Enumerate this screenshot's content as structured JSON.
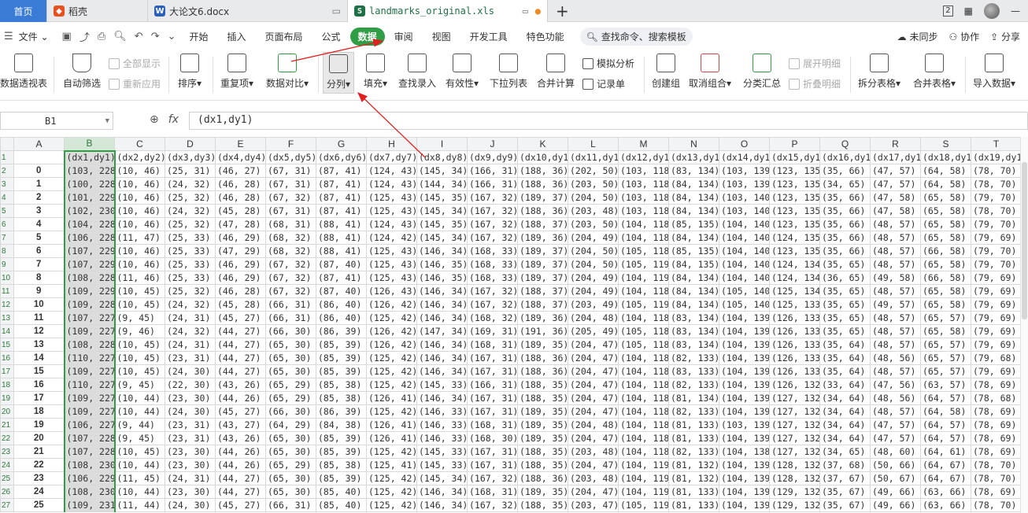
{
  "tabs": {
    "home": "首页",
    "daoke": "稻壳",
    "doc": "大论文6.docx",
    "xls": "landmarks_original.xls",
    "new": "+"
  },
  "window": {
    "badge": "2",
    "minimize": "—"
  },
  "menu": {
    "file": "文件",
    "items": [
      "开始",
      "插入",
      "页面布局",
      "公式",
      "数据",
      "审阅",
      "视图",
      "开发工具",
      "特色功能"
    ],
    "active": "数据",
    "search": "查找命令、搜索模板",
    "sync": "未同步",
    "collab": "协作",
    "share": "分享"
  },
  "ribbon": {
    "pivot": "数据透视表",
    "autofilter": "自动筛选",
    "showall": "全部显示",
    "reapply": "重新应用",
    "sort": "排序",
    "dup": "重复项",
    "compare": "数据对比",
    "split": "分列",
    "fill": "填充",
    "lookup": "查找录入",
    "valid": "有效性",
    "dropdown": "下拉列表",
    "merge": "合并计算",
    "simulate": "模拟分析",
    "record": "记录单",
    "group": "创建组",
    "ungroup": "取消组合",
    "subtotal": "分类汇总",
    "expand": "展开明细",
    "collapse": "折叠明细",
    "splittable": "拆分表格",
    "mergetable": "合并表格",
    "import": "导入数据"
  },
  "formula": {
    "cell": "B1",
    "fx": "fx",
    "content": "(dx1,dy1)"
  },
  "colors": {
    "accent": "#2f9e44",
    "arrow": "#e02020"
  },
  "grid": {
    "columns": [
      "A",
      "B",
      "C",
      "D",
      "E",
      "F",
      "G",
      "H",
      "I",
      "J",
      "K",
      "L",
      "M",
      "N",
      "O",
      "P",
      "Q",
      "R",
      "S",
      "T"
    ],
    "header": [
      "",
      "(dx1,dy1)",
      "(dx2,dy2)",
      "(dx3,dy3)",
      "(dx4,dy4)",
      "(dx5,dy5)",
      "(dx6,dy6)",
      "(dx7,dy7)",
      "(dx8,dy8)",
      "(dx9,dy9)",
      "(dx10,dy10",
      "(dx11,dy11",
      "(dx12,dy12",
      "(dx13,dy13",
      "(dx14,dy14",
      "(dx15,dy15",
      "(dx16,dy16",
      "(dx17,dy17",
      "(dx18,dy18",
      "(dx19,dy1"
    ],
    "rows": [
      [
        "0",
        "(103, 228)",
        "(10, 46)",
        "(25, 31)",
        "(46, 27)",
        "(67, 31)",
        "(87, 41)",
        "(124, 43)",
        "(145, 34)",
        "(166, 31)",
        "(188, 36)",
        "(202, 50)",
        "(103, 118)",
        "(83, 134)",
        "(103, 139)",
        "(123, 135)",
        "(35, 66)",
        "(47, 57)",
        "(64, 58)",
        "(78, 70)"
      ],
      [
        "1",
        "(100, 228)",
        "(10, 46)",
        "(24, 32)",
        "(46, 28)",
        "(67, 31)",
        "(87, 41)",
        "(124, 43)",
        "(144, 34)",
        "(166, 31)",
        "(188, 36)",
        "(203, 50)",
        "(103, 118)",
        "(84, 134)",
        "(103, 139)",
        "(123, 135)",
        "(34, 65)",
        "(47, 57)",
        "(64, 58)",
        "(78, 70)"
      ],
      [
        "2",
        "(101, 229)",
        "(10, 46)",
        "(25, 32)",
        "(46, 28)",
        "(67, 32)",
        "(87, 41)",
        "(125, 43)",
        "(145, 35)",
        "(167, 32)",
        "(189, 37)",
        "(204, 50)",
        "(103, 118)",
        "(84, 134)",
        "(103, 140)",
        "(123, 135)",
        "(35, 66)",
        "(47, 58)",
        "(65, 58)",
        "(79, 70)"
      ],
      [
        "3",
        "(102, 230)",
        "(10, 46)",
        "(24, 32)",
        "(45, 28)",
        "(67, 31)",
        "(87, 41)",
        "(125, 43)",
        "(145, 34)",
        "(167, 32)",
        "(188, 36)",
        "(203, 48)",
        "(103, 118)",
        "(84, 134)",
        "(103, 140)",
        "(123, 135)",
        "(35, 66)",
        "(47, 58)",
        "(65, 58)",
        "(78, 70)"
      ],
      [
        "4",
        "(104, 228)",
        "(10, 46)",
        "(25, 32)",
        "(47, 28)",
        "(68, 31)",
        "(88, 41)",
        "(124, 43)",
        "(145, 35)",
        "(167, 32)",
        "(188, 37)",
        "(203, 50)",
        "(104, 118)",
        "(85, 135)",
        "(104, 140)",
        "(123, 135)",
        "(35, 66)",
        "(48, 57)",
        "(65, 58)",
        "(79, 70)"
      ],
      [
        "5",
        "(106, 228)",
        "(11, 47)",
        "(25, 33)",
        "(46, 29)",
        "(68, 32)",
        "(88, 41)",
        "(124, 42)",
        "(145, 34)",
        "(167, 32)",
        "(189, 36)",
        "(204, 49)",
        "(104, 118)",
        "(84, 134)",
        "(104, 140)",
        "(124, 135)",
        "(35, 66)",
        "(48, 57)",
        "(65, 58)",
        "(79, 69)"
      ],
      [
        "6",
        "(107, 229)",
        "(10, 46)",
        "(25, 33)",
        "(47, 29)",
        "(68, 32)",
        "(88, 41)",
        "(125, 43)",
        "(146, 34)",
        "(168, 33)",
        "(189, 37)",
        "(204, 50)",
        "(105, 118)",
        "(85, 135)",
        "(104, 140)",
        "(123, 135)",
        "(35, 66)",
        "(48, 57)",
        "(66, 58)",
        "(79, 70)"
      ],
      [
        "7",
        "(107, 229)",
        "(10, 46)",
        "(25, 33)",
        "(46, 29)",
        "(67, 32)",
        "(87, 40)",
        "(125, 43)",
        "(146, 35)",
        "(168, 33)",
        "(189, 37)",
        "(204, 50)",
        "(105, 119)",
        "(84, 135)",
        "(104, 140)",
        "(124, 134)",
        "(35, 65)",
        "(48, 57)",
        "(65, 58)",
        "(79, 70)"
      ],
      [
        "8",
        "(108, 228)",
        "(11, 46)",
        "(25, 33)",
        "(46, 29)",
        "(67, 32)",
        "(87, 41)",
        "(125, 43)",
        "(146, 35)",
        "(168, 33)",
        "(189, 37)",
        "(204, 49)",
        "(104, 119)",
        "(84, 134)",
        "(104, 140)",
        "(124, 134)",
        "(36, 65)",
        "(49, 58)",
        "(66, 58)",
        "(79, 69)"
      ],
      [
        "9",
        "(109, 229)",
        "(10, 45)",
        "(25, 32)",
        "(46, 28)",
        "(67, 32)",
        "(87, 40)",
        "(126, 43)",
        "(146, 34)",
        "(167, 32)",
        "(188, 37)",
        "(204, 49)",
        "(104, 118)",
        "(84, 134)",
        "(105, 140)",
        "(125, 134)",
        "(35, 65)",
        "(48, 57)",
        "(65, 58)",
        "(79, 69)"
      ],
      [
        "10",
        "(109, 228)",
        "(10, 45)",
        "(24, 32)",
        "(45, 28)",
        "(66, 31)",
        "(86, 40)",
        "(126, 42)",
        "(146, 34)",
        "(167, 32)",
        "(188, 37)",
        "(203, 49)",
        "(105, 119)",
        "(84, 134)",
        "(105, 140)",
        "(125, 133)",
        "(35, 65)",
        "(49, 57)",
        "(65, 58)",
        "(79, 69)"
      ],
      [
        "11",
        "(107, 227)",
        "(9, 45)",
        "(24, 31)",
        "(45, 27)",
        "(66, 31)",
        "(86, 40)",
        "(125, 42)",
        "(146, 34)",
        "(168, 32)",
        "(189, 36)",
        "(204, 48)",
        "(104, 118)",
        "(83, 134)",
        "(104, 139)",
        "(126, 133)",
        "(35, 65)",
        "(48, 57)",
        "(65, 57)",
        "(79, 69)"
      ],
      [
        "12",
        "(109, 227)",
        "(9, 46)",
        "(24, 32)",
        "(44, 27)",
        "(66, 30)",
        "(86, 39)",
        "(126, 42)",
        "(147, 34)",
        "(169, 31)",
        "(191, 36)",
        "(205, 49)",
        "(105, 118)",
        "(83, 134)",
        "(104, 139)",
        "(126, 133)",
        "(35, 65)",
        "(48, 57)",
        "(65, 58)",
        "(79, 69)"
      ],
      [
        "13",
        "(108, 228)",
        "(10, 45)",
        "(24, 31)",
        "(44, 27)",
        "(65, 30)",
        "(85, 39)",
        "(126, 42)",
        "(146, 34)",
        "(168, 31)",
        "(189, 35)",
        "(204, 47)",
        "(105, 118)",
        "(83, 134)",
        "(104, 139)",
        "(126, 133)",
        "(35, 64)",
        "(48, 57)",
        "(65, 57)",
        "(79, 69)"
      ],
      [
        "14",
        "(110, 227)",
        "(10, 45)",
        "(23, 31)",
        "(44, 27)",
        "(65, 30)",
        "(85, 39)",
        "(125, 42)",
        "(146, 34)",
        "(167, 31)",
        "(188, 36)",
        "(204, 47)",
        "(104, 118)",
        "(82, 133)",
        "(104, 139)",
        "(126, 133)",
        "(35, 64)",
        "(48, 56)",
        "(65, 57)",
        "(79, 68)"
      ],
      [
        "15",
        "(109, 227)",
        "(10, 45)",
        "(24, 30)",
        "(44, 27)",
        "(65, 30)",
        "(85, 39)",
        "(125, 42)",
        "(146, 34)",
        "(167, 31)",
        "(188, 36)",
        "(204, 47)",
        "(104, 118)",
        "(83, 133)",
        "(104, 139)",
        "(126, 133)",
        "(35, 64)",
        "(48, 57)",
        "(65, 57)",
        "(79, 69)"
      ],
      [
        "16",
        "(110, 227)",
        "(9, 45)",
        "(22, 30)",
        "(43, 26)",
        "(65, 29)",
        "(85, 38)",
        "(125, 42)",
        "(145, 33)",
        "(166, 31)",
        "(188, 35)",
        "(204, 47)",
        "(104, 118)",
        "(82, 133)",
        "(104, 139)",
        "(126, 132)",
        "(33, 64)",
        "(47, 56)",
        "(63, 57)",
        "(78, 69)"
      ],
      [
        "17",
        "(109, 227)",
        "(10, 44)",
        "(23, 30)",
        "(44, 26)",
        "(65, 29)",
        "(85, 38)",
        "(126, 41)",
        "(146, 34)",
        "(167, 31)",
        "(188, 35)",
        "(204, 47)",
        "(104, 118)",
        "(81, 134)",
        "(104, 139)",
        "(127, 132)",
        "(34, 64)",
        "(48, 56)",
        "(64, 57)",
        "(78, 68)"
      ],
      [
        "18",
        "(109, 227)",
        "(10, 44)",
        "(24, 30)",
        "(45, 27)",
        "(66, 30)",
        "(86, 39)",
        "(125, 42)",
        "(146, 33)",
        "(167, 31)",
        "(189, 35)",
        "(204, 47)",
        "(104, 118)",
        "(82, 133)",
        "(104, 139)",
        "(127, 132)",
        "(34, 64)",
        "(48, 57)",
        "(64, 58)",
        "(78, 69)"
      ],
      [
        "19",
        "(106, 227)",
        "(9, 44)",
        "(23, 31)",
        "(43, 27)",
        "(64, 29)",
        "(84, 38)",
        "(126, 41)",
        "(146, 33)",
        "(168, 31)",
        "(189, 35)",
        "(204, 48)",
        "(104, 118)",
        "(81, 133)",
        "(103, 139)",
        "(127, 132)",
        "(34, 64)",
        "(47, 57)",
        "(64, 57)",
        "(78, 69)"
      ],
      [
        "20",
        "(107, 228)",
        "(9, 45)",
        "(23, 31)",
        "(43, 26)",
        "(65, 30)",
        "(85, 39)",
        "(126, 41)",
        "(146, 33)",
        "(168, 30)",
        "(189, 35)",
        "(204, 47)",
        "(104, 118)",
        "(81, 133)",
        "(104, 139)",
        "(127, 132)",
        "(34, 64)",
        "(47, 57)",
        "(64, 57)",
        "(78, 69)"
      ],
      [
        "21",
        "(107, 228)",
        "(10, 45)",
        "(23, 30)",
        "(44, 26)",
        "(65, 30)",
        "(85, 39)",
        "(125, 42)",
        "(145, 33)",
        "(167, 31)",
        "(188, 35)",
        "(203, 48)",
        "(104, 118)",
        "(82, 133)",
        "(104, 138)",
        "(127, 132)",
        "(34, 65)",
        "(48, 60)",
        "(64, 61)",
        "(78, 69)"
      ],
      [
        "22",
        "(108, 230)",
        "(10, 44)",
        "(23, 30)",
        "(44, 26)",
        "(65, 29)",
        "(85, 38)",
        "(125, 41)",
        "(145, 33)",
        "(167, 31)",
        "(188, 35)",
        "(204, 47)",
        "(104, 119)",
        "(81, 132)",
        "(104, 139)",
        "(128, 132)",
        "(37, 68)",
        "(50, 66)",
        "(64, 67)",
        "(78, 70)"
      ],
      [
        "23",
        "(106, 229)",
        "(11, 45)",
        "(24, 31)",
        "(44, 27)",
        "(65, 30)",
        "(85, 39)",
        "(125, 42)",
        "(145, 34)",
        "(167, 32)",
        "(188, 36)",
        "(203, 48)",
        "(104, 119)",
        "(81, 132)",
        "(104, 139)",
        "(128, 132)",
        "(37, 67)",
        "(50, 67)",
        "(64, 67)",
        "(78, 70)"
      ],
      [
        "24",
        "(108, 230)",
        "(10, 44)",
        "(23, 30)",
        "(44, 27)",
        "(65, 30)",
        "(85, 40)",
        "(125, 42)",
        "(146, 34)",
        "(168, 31)",
        "(189, 35)",
        "(204, 47)",
        "(104, 119)",
        "(81, 133)",
        "(104, 139)",
        "(129, 132)",
        "(35, 67)",
        "(49, 66)",
        "(63, 66)",
        "(78, 69)"
      ],
      [
        "25",
        "(109, 231)",
        "(11, 44)",
        "(24, 30)",
        "(45, 27)",
        "(66, 31)",
        "(85, 40)",
        "(125, 42)",
        "(146, 34)",
        "(167, 32)",
        "(188, 35)",
        "(203, 47)",
        "(105, 119)",
        "(81, 133)",
        "(104, 139)",
        "(129, 132)",
        "(35, 67)",
        "(49, 66)",
        "(63, 66)",
        "(78, 70)"
      ]
    ]
  }
}
